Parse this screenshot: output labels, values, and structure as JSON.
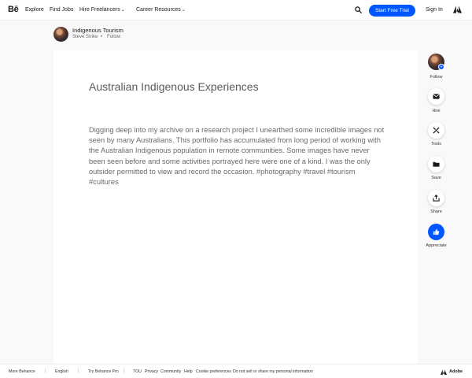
{
  "nav": {
    "logo": "Bē",
    "items": [
      "Explore",
      "Find Jobs",
      "Hire Freelancers",
      "Career Resources"
    ],
    "cta": "Start Free Trial",
    "signin": "Sign In"
  },
  "project": {
    "title": "Indigenous Tourism",
    "owner": "Steve Strike",
    "dot": "•",
    "follow": "Follow"
  },
  "content": {
    "headline": "Australian Indigenous Experiences",
    "description": "Digging deep into my archive on a research project I unearthed some incredible images not seen by many Australians. This portfolio has accumulated from long period of working with the Australian Indigenous population in remote communities. Some images have never been seen before and some activities portrayed here were one of a kind. I was the only outsider permitted to view and record the occasion. #photography #travel #tourism #cultures"
  },
  "rail": {
    "plus": "+",
    "follow": "Follow",
    "hire": "Hire",
    "tools": "Tools",
    "save": "Save",
    "share": "Share",
    "appreciate": "Appreciate"
  },
  "footer": {
    "more": "More Behance",
    "language": "English",
    "try": "Try Behance Pro",
    "links": [
      "TOU",
      "Privacy",
      "Community",
      "Help",
      "Cookie preferences",
      "Do not sell or share my personal information"
    ],
    "adobe": "Adobe",
    "sep": "|"
  },
  "colors": {
    "accent": "#0057ff",
    "background": "#f9f9f9",
    "panel": "#ffffff"
  },
  "icons": [
    "search-icon",
    "adobe-logo-icon",
    "mail-icon",
    "tools-icon",
    "save-icon",
    "share-icon",
    "thumbs-up-icon"
  ]
}
